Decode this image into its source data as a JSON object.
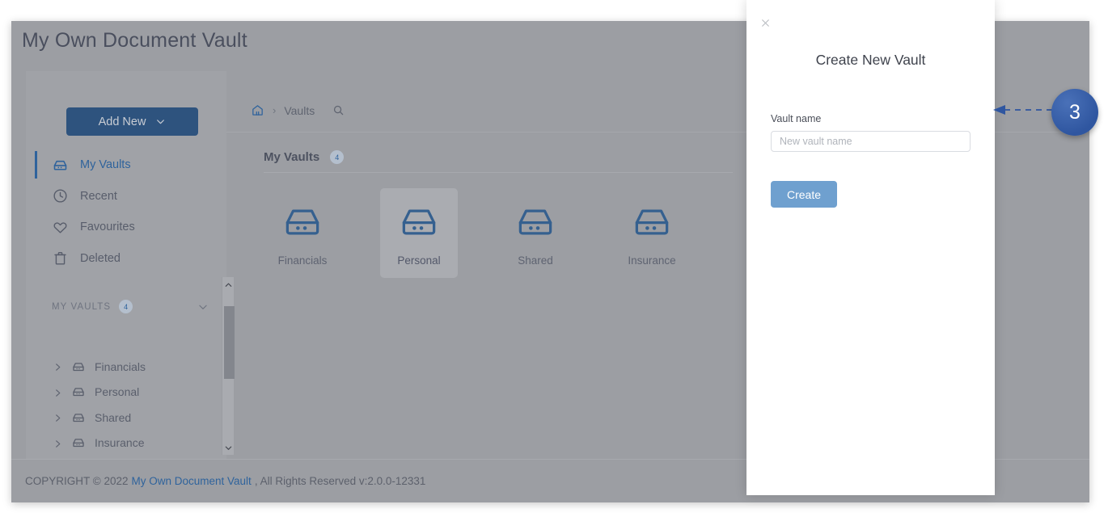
{
  "app": {
    "title": "My Own Document Vault"
  },
  "sidebar": {
    "add_new_label": "Add New",
    "nav": [
      {
        "label": "My Vaults",
        "icon": "vault-icon",
        "active": true
      },
      {
        "label": "Recent",
        "icon": "clock-icon",
        "active": false
      },
      {
        "label": "Favourites",
        "icon": "heart-icon",
        "active": false
      },
      {
        "label": "Deleted",
        "icon": "trash-icon",
        "active": false
      }
    ],
    "group": {
      "title": "MY VAULTS",
      "count": "4",
      "chevron_icon": "chevron-down-icon"
    },
    "tree": [
      {
        "label": "Financials",
        "caret_icon": "chevron-right-icon",
        "icon": "vault-icon"
      },
      {
        "label": "Personal",
        "caret_icon": "chevron-right-icon",
        "icon": "vault-icon"
      },
      {
        "label": "Shared",
        "caret_icon": "chevron-right-icon",
        "icon": "vault-icon"
      },
      {
        "label": "Insurance",
        "caret_icon": "chevron-right-icon",
        "icon": "vault-icon"
      }
    ],
    "scrollbar": {
      "up_icon": "chevron-up-icon",
      "down_icon": "chevron-down-icon"
    }
  },
  "main": {
    "breadcrumb": {
      "home_icon": "home-icon",
      "separator": "›",
      "current": "Vaults",
      "search_icon": "search-icon"
    },
    "section": {
      "title": "My Vaults",
      "count": "4"
    },
    "vaults": [
      {
        "name": "Financials",
        "icon": "vault-icon",
        "selected": false
      },
      {
        "name": "Personal",
        "icon": "vault-icon",
        "selected": true
      },
      {
        "name": "Shared",
        "icon": "vault-icon",
        "selected": false
      },
      {
        "name": "Insurance",
        "icon": "vault-icon",
        "selected": false
      }
    ]
  },
  "footer": {
    "prefix": "COPYRIGHT © 2022",
    "brand": "My Own Document Vault",
    "suffix": ", All Rights Reserved v:2.0.0-12331"
  },
  "modal": {
    "close_icon": "close-icon",
    "title": "Create New Vault",
    "field_label": "Vault name",
    "input_value": "",
    "input_placeholder": "New vault name",
    "create_label": "Create"
  },
  "annotation": {
    "number": "3",
    "arrow_icon": "arrow-left-icon"
  },
  "colors": {
    "accent_blue": "#2f639c",
    "button_blue": "#2e537e",
    "create_blue": "#6fa0cf",
    "annotation_blue": "#2f56a0",
    "overlay_gray": "#9c9ea3",
    "panel_gray": "#a0a2a7",
    "text_dark": "#4a4f5e"
  }
}
